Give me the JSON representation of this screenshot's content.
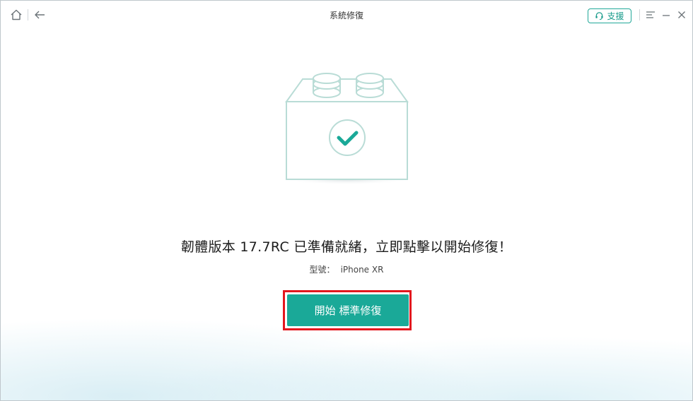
{
  "window": {
    "title": "系統修復",
    "support_label": "支援"
  },
  "titlebar_icons": {
    "home": "home-icon",
    "back": "back-arrow-icon",
    "support": "headset-icon",
    "menu": "menu-icon",
    "minimize": "minimize-icon",
    "close": "close-icon"
  },
  "main": {
    "headline": "韌體版本 17.7RC 已準備就緒，立即點擊以開始修復！",
    "model_label": "型號：",
    "model_value": "iPhone XR",
    "start_button_label": "開始 標準修復"
  },
  "colors": {
    "accent": "#1aa998",
    "illustration_stroke": "#b9dcd6",
    "highlight_border": "#e3171e"
  }
}
